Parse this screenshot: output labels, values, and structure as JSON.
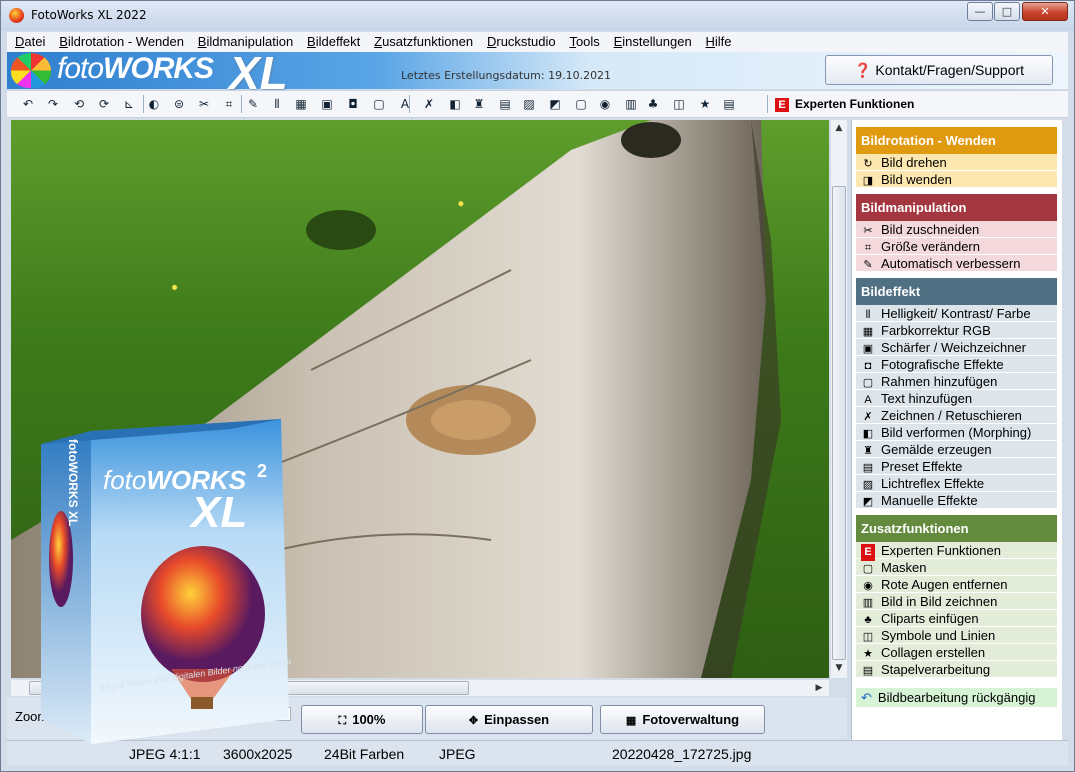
{
  "window": {
    "title": "FotoWorks XL 2022",
    "min": "—",
    "max": "□",
    "close": "✕"
  },
  "menu": [
    "Datei",
    "Bildrotation - Wenden",
    "Bildmanipulation",
    "Bildeffekt",
    "Zusatzfunktionen",
    "Druckstudio",
    "Tools",
    "Einstellungen",
    "Hilfe"
  ],
  "banner": {
    "brand_light": "foto",
    "brand_bold": "WORKS",
    "brand_xl": "XL",
    "date": "Letztes Erstellungsdatum: 19.10.2021",
    "support_label": "Kontakt/Fragen/Support",
    "support_icon": "❓"
  },
  "toolbar": {
    "icons": [
      "rotate-left-icon",
      "rotate-right-icon",
      "rotate-ccw-icon",
      "rotate-cw-icon",
      "rotate-free-icon",
      "flip-icon",
      "flip-vertical-icon",
      "cut-icon",
      "crop-icon",
      "auto-fix-icon",
      "levels-icon",
      "color-icon",
      "sharpen-icon",
      "photo-effects-icon",
      "frame-icon",
      "text-icon",
      "draw-icon",
      "morph-icon",
      "paint-icon",
      "preset-icon",
      "lightflare-icon",
      "manual-icon",
      "mask-icon",
      "red-eye-icon",
      "picture-in-picture-icon",
      "clipart-icon",
      "symbols-icon",
      "star-icon",
      "batch-icon"
    ],
    "glyphs": [
      "↶",
      "↷",
      "⟲",
      "⟳",
      "⊾",
      "◐",
      "⊜",
      "✂",
      "⌗",
      "✎",
      "⫴",
      "▦",
      "▣",
      "◘",
      "▢",
      "A",
      "✗",
      "◧",
      "♜",
      "▤",
      "▨",
      "◩",
      "▢",
      "◉",
      "▥",
      "♣",
      "◫",
      "★",
      "▤"
    ],
    "expert_icon": "E",
    "expert_label": "Experten Funktionen"
  },
  "bottom": {
    "zoom_label": "Zoom: 28",
    "btn_100": "100%",
    "btn_fit": "Einpassen",
    "btn_manage": "Fotoverwaltung"
  },
  "status": {
    "format": "JPEG  4:1:1",
    "dims": "3600x2025",
    "depth": "24Bit Farben",
    "type": "JPEG",
    "file": "20220428_172725.jpg"
  },
  "colors": {
    "rot": "#e09a10",
    "manip": "#a3363f",
    "effekt": "#4f6f82",
    "zusatz": "#638a3d"
  },
  "sidebar": {
    "rotation": {
      "title": "Bildrotation - Wenden",
      "items": [
        {
          "label": "Bild drehen",
          "icon": "↻"
        },
        {
          "label": "Bild wenden",
          "icon": "◨"
        }
      ]
    },
    "manipulation": {
      "title": "Bildmanipulation",
      "items": [
        {
          "label": "Bild zuschneiden",
          "icon": "✂"
        },
        {
          "label": "Größe verändern",
          "icon": "⌗"
        },
        {
          "label": "Automatisch verbessern",
          "icon": "✎"
        }
      ]
    },
    "effekt": {
      "title": "Bildeffekt",
      "items": [
        {
          "label": "Helligkeit/ Kontrast/ Farbe",
          "icon": "⫴"
        },
        {
          "label": "Farbkorrektur RGB",
          "icon": "▦"
        },
        {
          "label": "Schärfer / Weichzeichner",
          "icon": "▣"
        },
        {
          "label": "Fotografische Effekte",
          "icon": "◘"
        },
        {
          "label": "Rahmen hinzufügen",
          "icon": "▢"
        },
        {
          "label": "Text hinzufügen",
          "icon": "A"
        },
        {
          "label": "Zeichnen / Retuschieren",
          "icon": "✗"
        },
        {
          "label": "Bild verformen (Morphing)",
          "icon": "◧"
        },
        {
          "label": "Gemälde erzeugen",
          "icon": "♜"
        },
        {
          "label": "Preset Effekte",
          "icon": "▤"
        },
        {
          "label": "Lichtreflex Effekte",
          "icon": "▨"
        },
        {
          "label": "Manuelle Effekte",
          "icon": "◩"
        }
      ]
    },
    "zusatz": {
      "title": "Zusatzfunktionen",
      "items": [
        {
          "label": "Experten Funktionen",
          "icon": "E"
        },
        {
          "label": "Masken",
          "icon": "▢"
        },
        {
          "label": "Rote Augen entfernen",
          "icon": "◉"
        },
        {
          "label": "Bild in Bild zeichnen",
          "icon": "▥"
        },
        {
          "label": "Cliparts einfügen",
          "icon": "♣"
        },
        {
          "label": "Symbole und Linien",
          "icon": "◫"
        },
        {
          "label": "Collagen erstellen",
          "icon": "★"
        },
        {
          "label": "Stapelverarbeitung",
          "icon": "▤"
        }
      ]
    },
    "undo": {
      "label": "Bildbearbeitung rückgängig",
      "icon": "↶"
    }
  },
  "box": {
    "brand_light": "foto",
    "brand_bold": "WORKS",
    "brand_xl": "XL",
    "version": "2",
    "spine": "fotoWORKS XL",
    "slogan": "So gut haben Ihre digitalen Bilder noch nie ausgesehen!"
  }
}
